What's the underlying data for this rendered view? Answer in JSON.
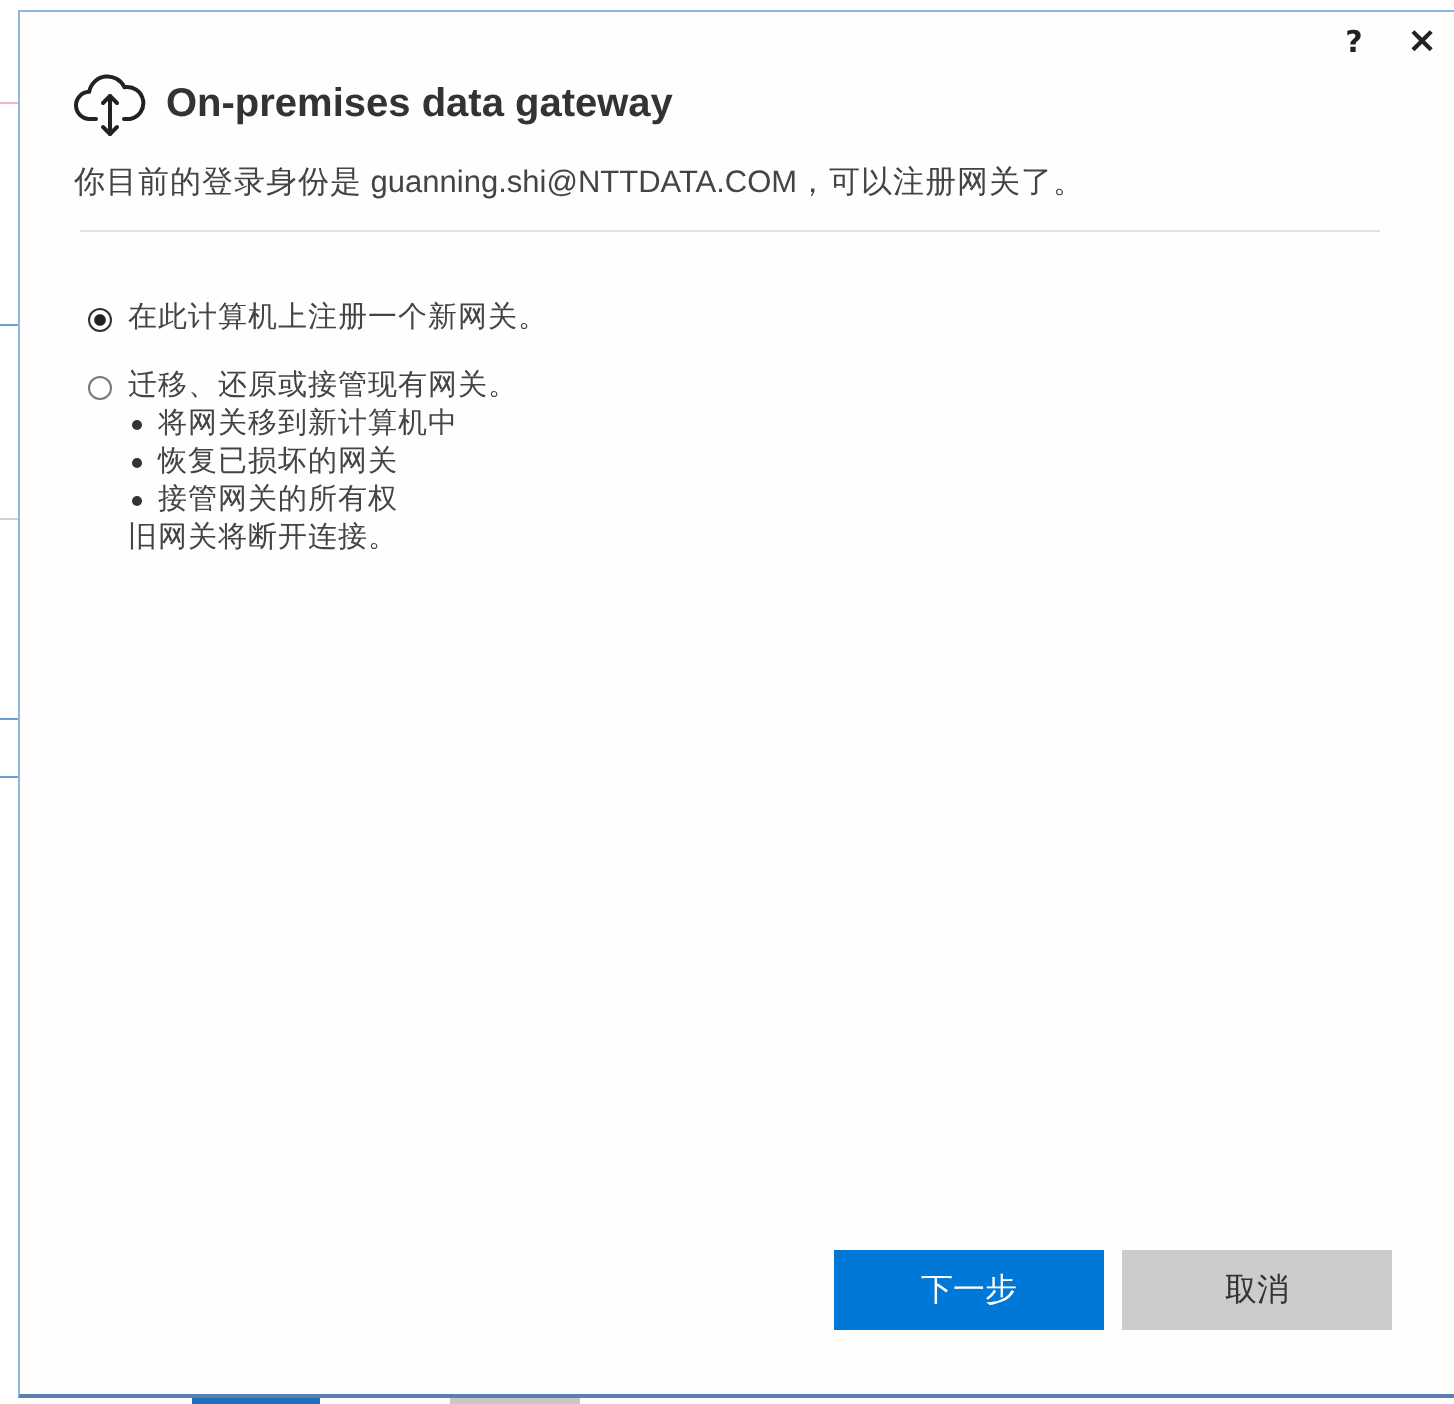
{
  "window": {
    "help": "?",
    "close": "×"
  },
  "header": {
    "title": "On-premises data gateway",
    "signed_in_message": "你目前的登录身份是 guanning.shi@NTTDATA.COM，可以注册网关了。"
  },
  "options": [
    {
      "label": "在此计算机上注册一个新网关。",
      "selected": true
    },
    {
      "label": "迁移、还原或接管现有网关。",
      "selected": false,
      "bullets": [
        "将网关移到新计算机中",
        "恢复已损坏的网关",
        "接管网关的所有权"
      ],
      "note": "旧网关将断开连接。"
    }
  ],
  "buttons": [
    {
      "label": "下一步",
      "kind": "primary"
    },
    {
      "label": "取消",
      "kind": "secondary"
    }
  ]
}
